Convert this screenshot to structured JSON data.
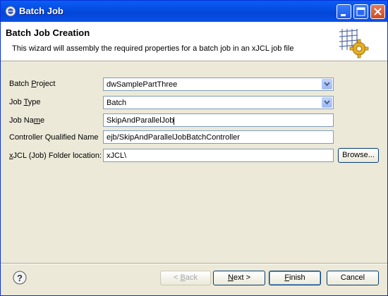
{
  "window": {
    "title": "Batch Job"
  },
  "banner": {
    "title": "Batch Job Creation",
    "description": "This wizard will assembly the required properties for a batch job in an xJCL job file"
  },
  "form": {
    "batch_project": {
      "label_pre": "Batch ",
      "label_mn": "P",
      "label_post": "roject",
      "value": "dwSamplePartThree"
    },
    "job_type": {
      "label_pre": "Job ",
      "label_mn": "T",
      "label_post": "ype",
      "value": "Batch"
    },
    "job_name": {
      "label_pre": "Job Na",
      "label_mn": "m",
      "label_post": "e",
      "value": "SkipAndParallelJob"
    },
    "controller": {
      "label": "Controller Qualified Name",
      "value": "ejb/SkipAndParallelJobBatchController"
    },
    "folder": {
      "label_pre": "",
      "label_mn": "x",
      "label_post": "JCL (Job) Folder location:",
      "value": "xJCL\\"
    }
  },
  "buttons": {
    "browse": "Browse...",
    "back_pre": "< ",
    "back_mn": "B",
    "back_post": "ack",
    "next_pre": "",
    "next_mn": "N",
    "next_post": "ext >",
    "finish_pre": "",
    "finish_mn": "F",
    "finish_post": "inish",
    "cancel": "Cancel"
  },
  "icons": {
    "app": "eclipse-icon",
    "wizard": "grid-gear-icon",
    "help": "help-question-icon"
  }
}
